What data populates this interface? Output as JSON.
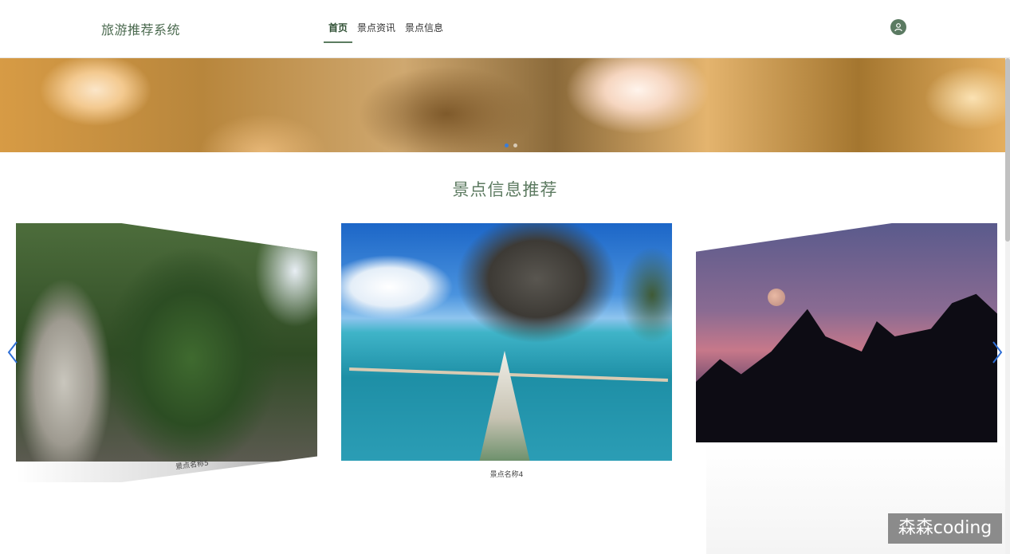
{
  "header": {
    "brand": "旅游推荐系统",
    "nav": [
      {
        "label": "首页",
        "active": true
      },
      {
        "label": "景点资讯",
        "active": false
      },
      {
        "label": "景点信息",
        "active": false
      }
    ],
    "user_icon": "user-icon"
  },
  "banner": {
    "dots": 2,
    "active_dot": 0
  },
  "section": {
    "title": "景点信息推荐"
  },
  "carousel": {
    "left_caption": "景点名称5",
    "center_caption": "景点名称4",
    "prev_icon": "chevron-left-icon",
    "next_icon": "chevron-right-icon"
  },
  "watermark": "森森coding",
  "colors": {
    "accent": "#5b7c60",
    "brand": "#4b6a4f",
    "arrow": "#2f6fd6"
  }
}
